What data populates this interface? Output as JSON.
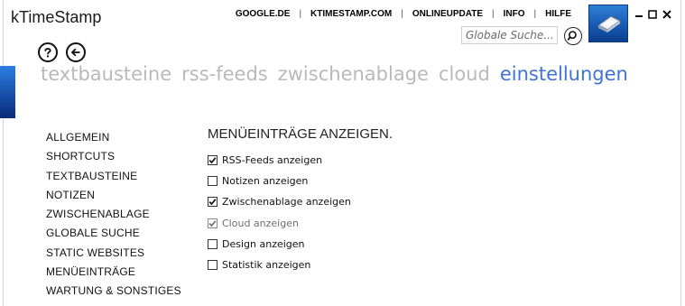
{
  "window": {
    "title": "kTimeStamp"
  },
  "topnav": {
    "links": [
      "GOOGLE.DE",
      "KTIMESTAMP.COM",
      "ONLINEUPDATE",
      "INFO",
      "HILFE"
    ],
    "separator": "|"
  },
  "search": {
    "placeholder": "Globale Suche...",
    "icon": "magnifier-icon"
  },
  "logo": {
    "icon": "stamp-logo-icon"
  },
  "window_controls": {
    "minimize": "minimize-icon",
    "maximize": "maximize-icon",
    "close": "close-icon"
  },
  "toolbar": {
    "help_icon": "help-icon",
    "back_icon": "back-arrow-icon"
  },
  "tabs": [
    {
      "label": "textbausteine",
      "active": false
    },
    {
      "label": "rss-feeds",
      "active": false
    },
    {
      "label": "zwischenablage",
      "active": false
    },
    {
      "label": "cloud",
      "active": false
    },
    {
      "label": "einstellungen",
      "active": true
    }
  ],
  "sidebar": {
    "items": [
      "ALLGEMEIN",
      "SHORTCUTS",
      "TEXTBAUSTEINE",
      "NOTIZEN",
      "ZWISCHENABLAGE",
      "GLOBALE SUCHE",
      "STATIC WEBSITES",
      "MENÜEINTRÄGE",
      "WARTUNG & SONSTIGES"
    ]
  },
  "main": {
    "section_title": "MENÜEINTRÄGE ANZEIGEN.",
    "options": [
      {
        "label": "RSS-Feeds anzeigen",
        "checked": true,
        "disabled": false
      },
      {
        "label": "Notizen anzeigen",
        "checked": false,
        "disabled": false
      },
      {
        "label": "Zwischenablage anzeigen",
        "checked": true,
        "disabled": false
      },
      {
        "label": "Cloud anzeigen",
        "checked": true,
        "disabled": true
      },
      {
        "label": "Design anzeigen",
        "checked": false,
        "disabled": false
      },
      {
        "label": "Statistik anzeigen",
        "checked": false,
        "disabled": false
      }
    ]
  },
  "colors": {
    "accent": "#3f74d4",
    "inactive_tab": "#b9b9b9",
    "logo_blue": "#1657b0"
  }
}
